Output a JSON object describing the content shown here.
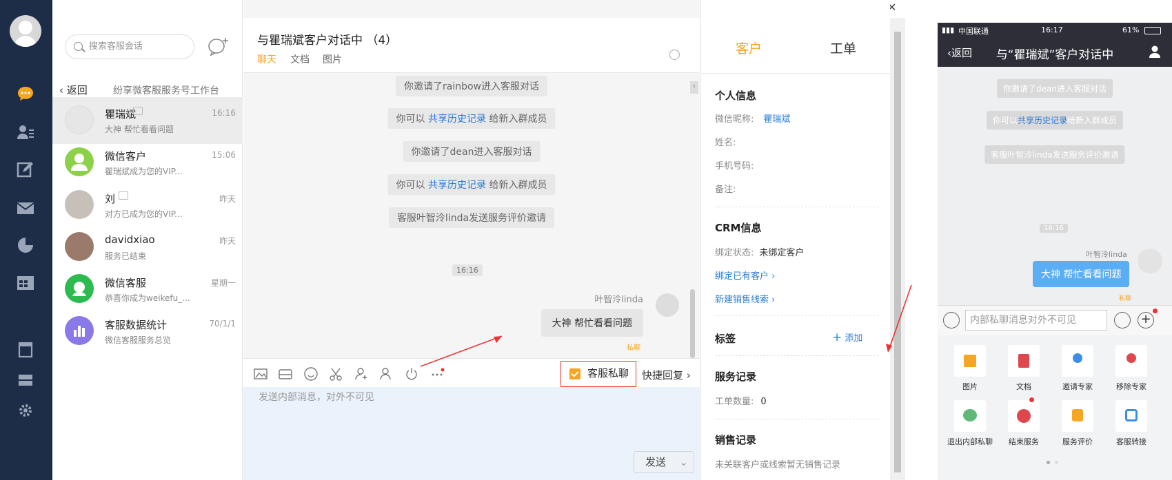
{
  "sidebar": {
    "icons": [
      "chat-icon",
      "contacts-icon",
      "edit-icon",
      "mail-icon",
      "pie-chart-icon",
      "calendar-icon",
      "clip-icon",
      "storage-icon",
      "gear-icon"
    ],
    "accent": "#f5a623"
  },
  "list": {
    "search_placeholder": "搜索客服会话",
    "back_label": "返回",
    "workspace": "纷享微客服服务号工作台",
    "items": [
      {
        "name": "瞿瑞斌",
        "time": "16:16",
        "preview": "大神 帮忙看看问题",
        "color": "#eee"
      },
      {
        "name": "微信客户",
        "time": "15:06",
        "preview": "瞿瑞斌成为您的VIP...",
        "color": "#8dd14b"
      },
      {
        "name": "刘",
        "time": "昨天",
        "preview": "对方已成为您的VIP...",
        "color": "#bbb"
      },
      {
        "name": "davidxiao",
        "time": "昨天",
        "preview": "服务已结束",
        "color": "#9a7a6a"
      },
      {
        "name": "微信客服",
        "time": "星期一",
        "preview": "恭喜你成为weikefu_...",
        "color": "#2dbb4f"
      },
      {
        "name": "客服数据统计",
        "time": "70/1/1",
        "preview": "微信客服服务总览",
        "color": "#8a79e8"
      }
    ]
  },
  "chat": {
    "title": "与瞿瑞斌客户对话中  （4）",
    "tabs": [
      "聊天",
      "文档",
      "图片"
    ],
    "sys1": "你邀请了rainbow进入客服对话",
    "sys2a": "你可以 ",
    "sys2link": "共享历史记录",
    "sys2b": " 给新入群成员",
    "sys3": "你邀请了dean进入客服对话",
    "sys4a": "你可以 ",
    "sys4link": "共享历史记录",
    "sys4b": " 给新入群成员",
    "sys5": "客服叶智泠linda发送服务评价邀请",
    "timestamp": "16:16",
    "sender": "叶智泠linda",
    "message": "大神 帮忙看看问题",
    "message_flag": "私聊",
    "private_label": "客服私聊",
    "quick_reply": "快捷回复",
    "input_placeholder": "发送内部消息，对外不可见",
    "send_label": "发送"
  },
  "right": {
    "tabs": [
      "客户",
      "工单"
    ],
    "personal_title": "个人信息",
    "wechat_label": "微信昵称:",
    "wechat_value": "瞿瑞斌",
    "name_label": "姓名:",
    "phone_label": "手机号码:",
    "note_label": "备注:",
    "crm_title": "CRM信息",
    "bind_label": "绑定状态:",
    "bind_value": "未绑定客户",
    "bind_existing": "绑定已有客户",
    "new_lead": "新建销售线索",
    "tags_title": "标签",
    "add_tag": "添加",
    "service_title": "服务记录",
    "ticket_label": "工单数量:",
    "ticket_value": "0",
    "sales_title": "销售记录",
    "sales_note": "未关联客户或线索暂无销售记录"
  },
  "phone": {
    "carrier": "中国联通",
    "clock": "16:17",
    "battery": "61%",
    "back": "返回",
    "title": "与“瞿瑞斌”客户对话中",
    "sys1": "你邀请了dean进入客服对话",
    "sys2a": "你可以",
    "sys2link": "共享历史记录",
    "sys2b": "给新入群成员",
    "sys3": "客服叶智泠linda发送服务评价邀请",
    "timestamp": "16:16",
    "sender": "叶智泠linda",
    "message": "大神 帮忙看看问题",
    "flag": "私聊",
    "input_placeholder": "内部私聊消息对外不可见",
    "grid": [
      "图片",
      "文档",
      "邀请专家",
      "移除专家",
      "退出内部私聊",
      "结束服务",
      "服务评价",
      "客服转接"
    ]
  }
}
